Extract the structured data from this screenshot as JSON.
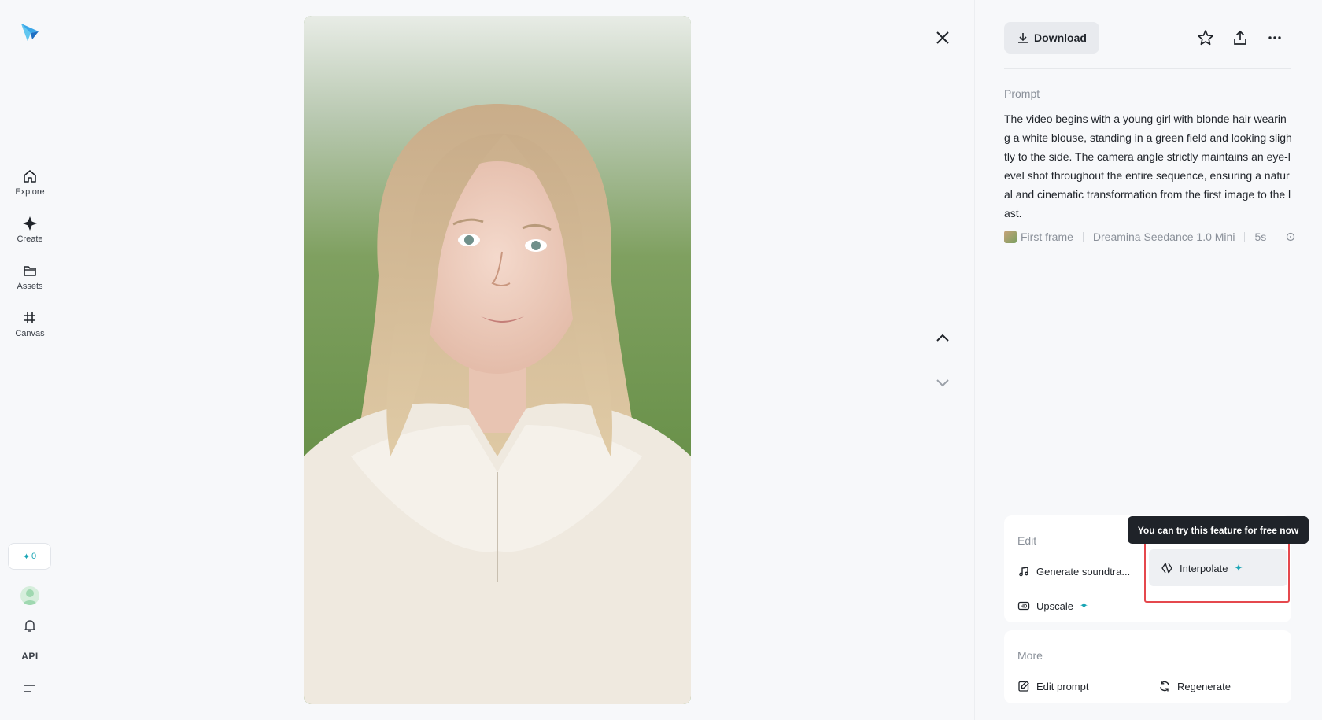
{
  "sidebar": {
    "items": [
      {
        "label": "Explore",
        "icon": "home-icon"
      },
      {
        "label": "Create",
        "icon": "diamond-icon"
      },
      {
        "label": "Assets",
        "icon": "folder-icon"
      },
      {
        "label": "Canvas",
        "icon": "canvas-icon"
      }
    ],
    "credits": "0",
    "api_label": "API"
  },
  "toolbar": {
    "download_label": "Download"
  },
  "prompt": {
    "label": "Prompt",
    "text": "The video begins with a young girl with blonde hair wearing a white blouse, standing in a green field and looking slightly to the side. The camera angle strictly maintains an eye-level shot throughout the entire sequence, ensuring a natural and cinematic transformation from the first image to the last.",
    "first_frame": "First frame",
    "model": "Dreamina Seedance 1.0 Mini",
    "duration": "5s"
  },
  "edit": {
    "title": "Edit",
    "generate_soundtrack": "Generate soundtra...",
    "interpolate": "Interpolate",
    "upscale": "Upscale",
    "tooltip": "You can try this feature for free now"
  },
  "more": {
    "title": "More",
    "edit_prompt": "Edit prompt",
    "regenerate": "Regenerate"
  },
  "colors": {
    "accent": "#1aa5b5",
    "highlight_border": "#e5484d",
    "tooltip_bg": "#1f2329"
  }
}
